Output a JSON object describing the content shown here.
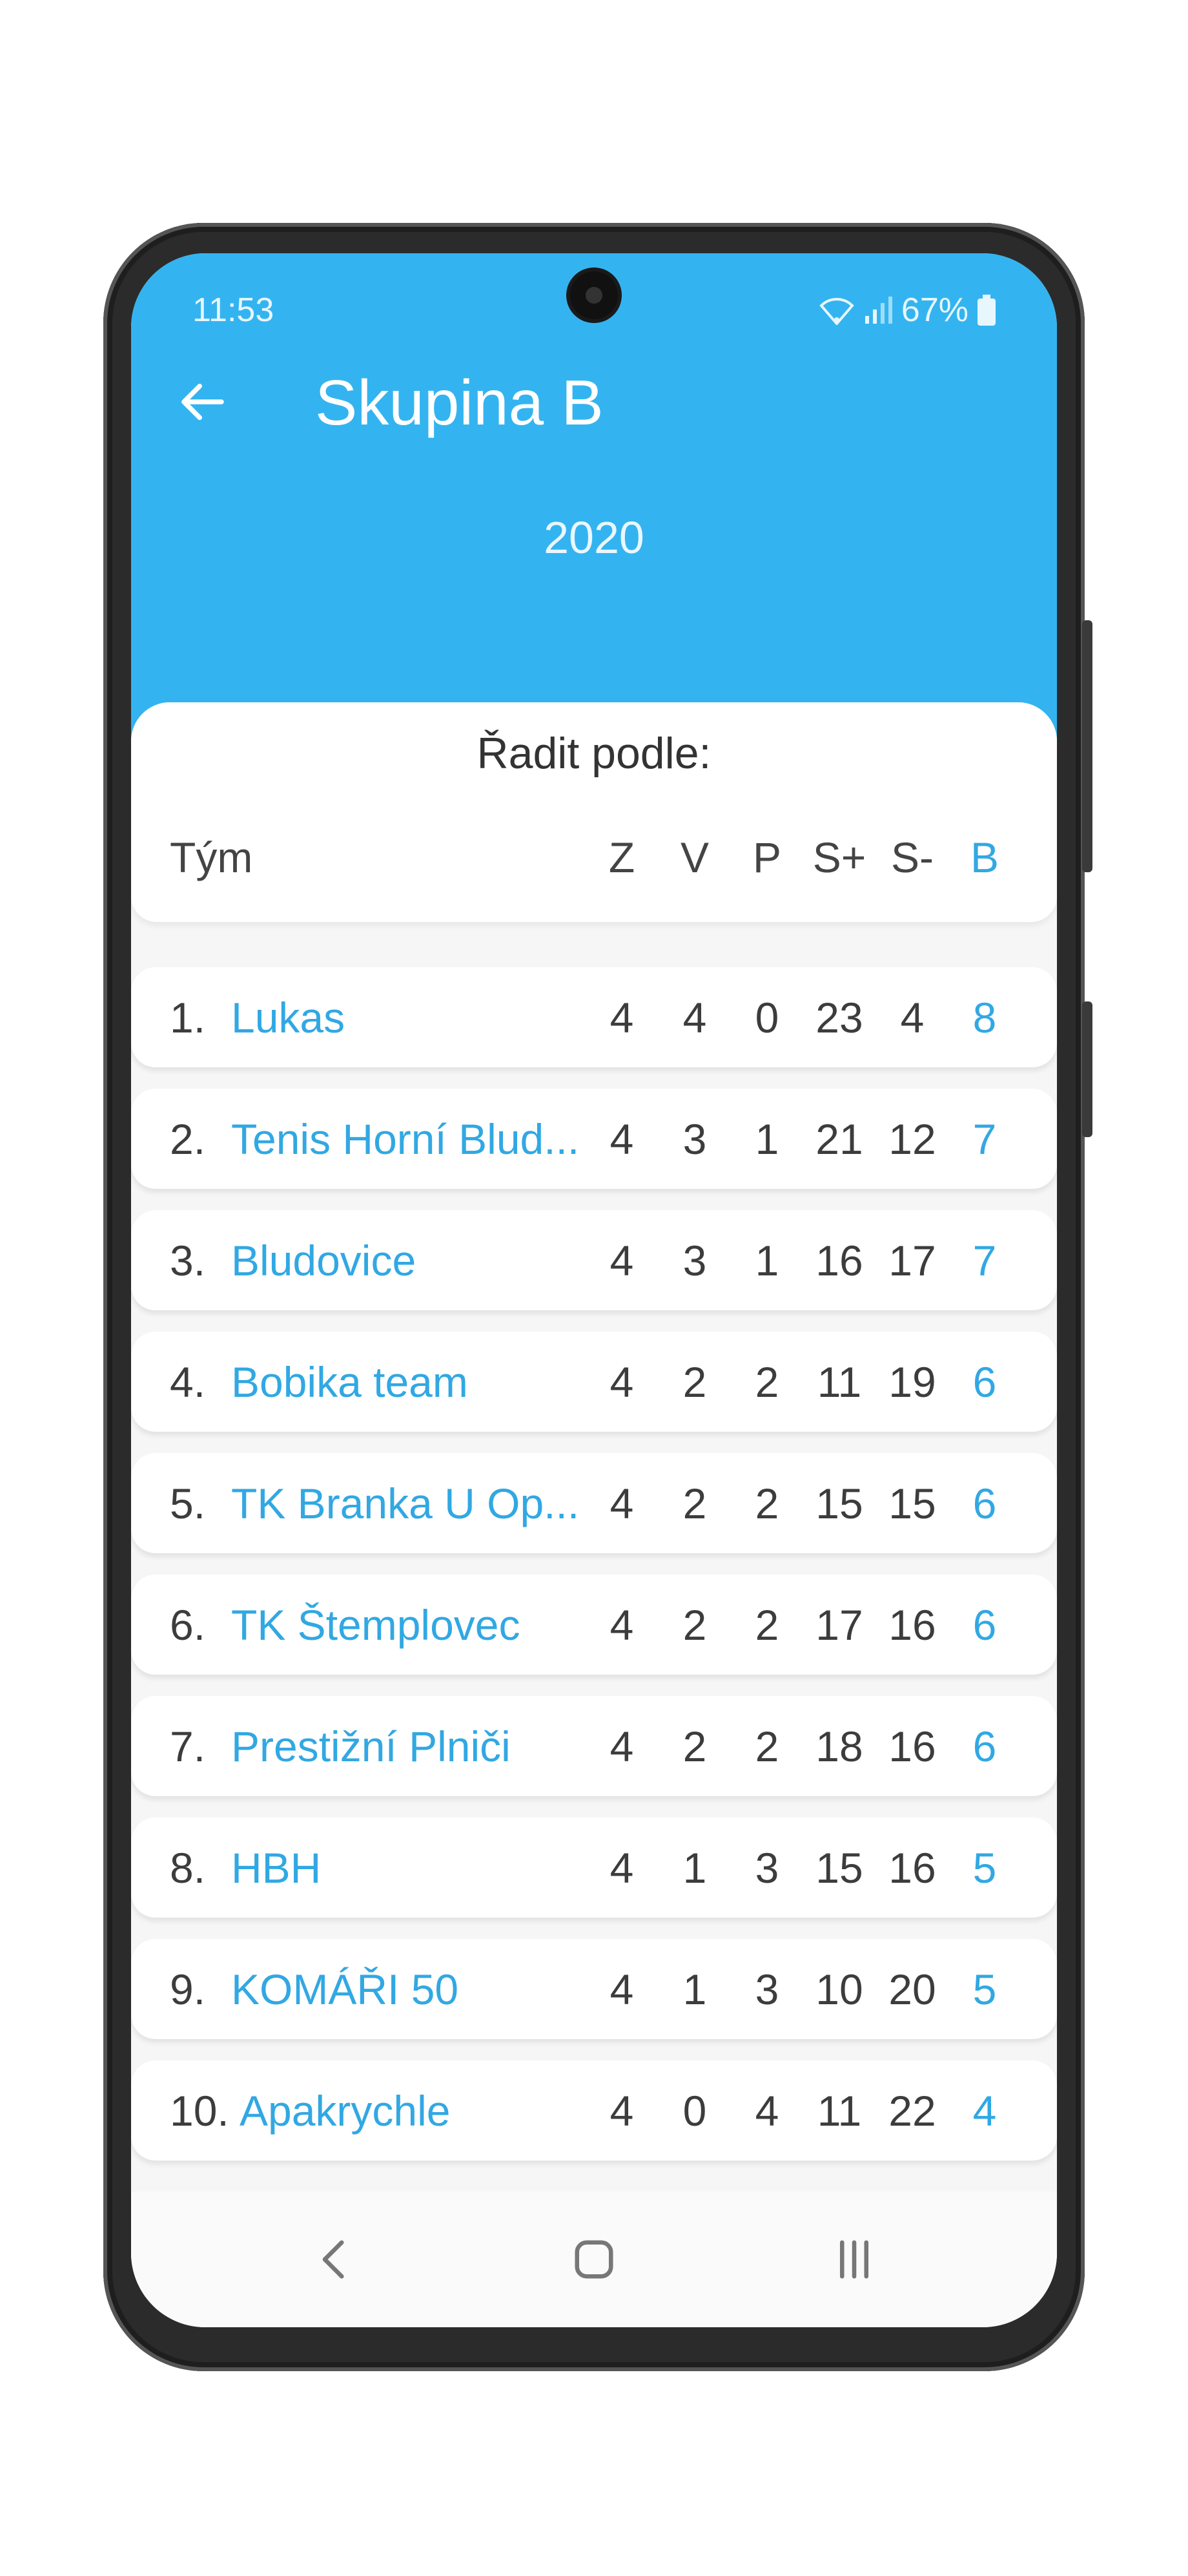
{
  "status_bar": {
    "time": "11:53",
    "battery": "67%"
  },
  "header": {
    "title": "Skupina B",
    "year": "2020"
  },
  "sort": {
    "label": "Řadit podle:"
  },
  "columns": {
    "team": "Tým",
    "z": "Z",
    "v": "V",
    "p": "P",
    "s_plus": "S+",
    "s_minus": "S-",
    "b": "B"
  },
  "rows": [
    {
      "rank": "1.",
      "team": "Lukas",
      "z": "4",
      "v": "4",
      "p": "0",
      "s_plus": "23",
      "s_minus": "4",
      "b": "8"
    },
    {
      "rank": "2.",
      "team": "Tenis Horní Blud...",
      "z": "4",
      "v": "3",
      "p": "1",
      "s_plus": "21",
      "s_minus": "12",
      "b": "7"
    },
    {
      "rank": "3.",
      "team": "Bludovice",
      "z": "4",
      "v": "3",
      "p": "1",
      "s_plus": "16",
      "s_minus": "17",
      "b": "7"
    },
    {
      "rank": "4.",
      "team": "Bobika team",
      "z": "4",
      "v": "2",
      "p": "2",
      "s_plus": "11",
      "s_minus": "19",
      "b": "6"
    },
    {
      "rank": "5.",
      "team": "TK Branka U Op...",
      "z": "4",
      "v": "2",
      "p": "2",
      "s_plus": "15",
      "s_minus": "15",
      "b": "6"
    },
    {
      "rank": "6.",
      "team": "TK Štemplovec",
      "z": "4",
      "v": "2",
      "p": "2",
      "s_plus": "17",
      "s_minus": "16",
      "b": "6"
    },
    {
      "rank": "7.",
      "team": "Prestižní Plniči",
      "z": "4",
      "v": "2",
      "p": "2",
      "s_plus": "18",
      "s_minus": "16",
      "b": "6"
    },
    {
      "rank": "8.",
      "team": "HBH",
      "z": "4",
      "v": "1",
      "p": "3",
      "s_plus": "15",
      "s_minus": "16",
      "b": "5"
    },
    {
      "rank": "9.",
      "team": "KOMÁŘI 50",
      "z": "4",
      "v": "1",
      "p": "3",
      "s_plus": "10",
      "s_minus": "20",
      "b": "5"
    },
    {
      "rank": "10.",
      "team": "Apakrychle",
      "z": "4",
      "v": "0",
      "p": "4",
      "s_plus": "11",
      "s_minus": "22",
      "b": "4"
    }
  ],
  "colors": {
    "header_bg": "#33b4f0",
    "accent": "#31a8e3"
  },
  "icons": {
    "back": "arrow-left-icon",
    "nav_back": "chevron-left-icon",
    "nav_home": "home-icon",
    "nav_recents": "recents-icon"
  }
}
